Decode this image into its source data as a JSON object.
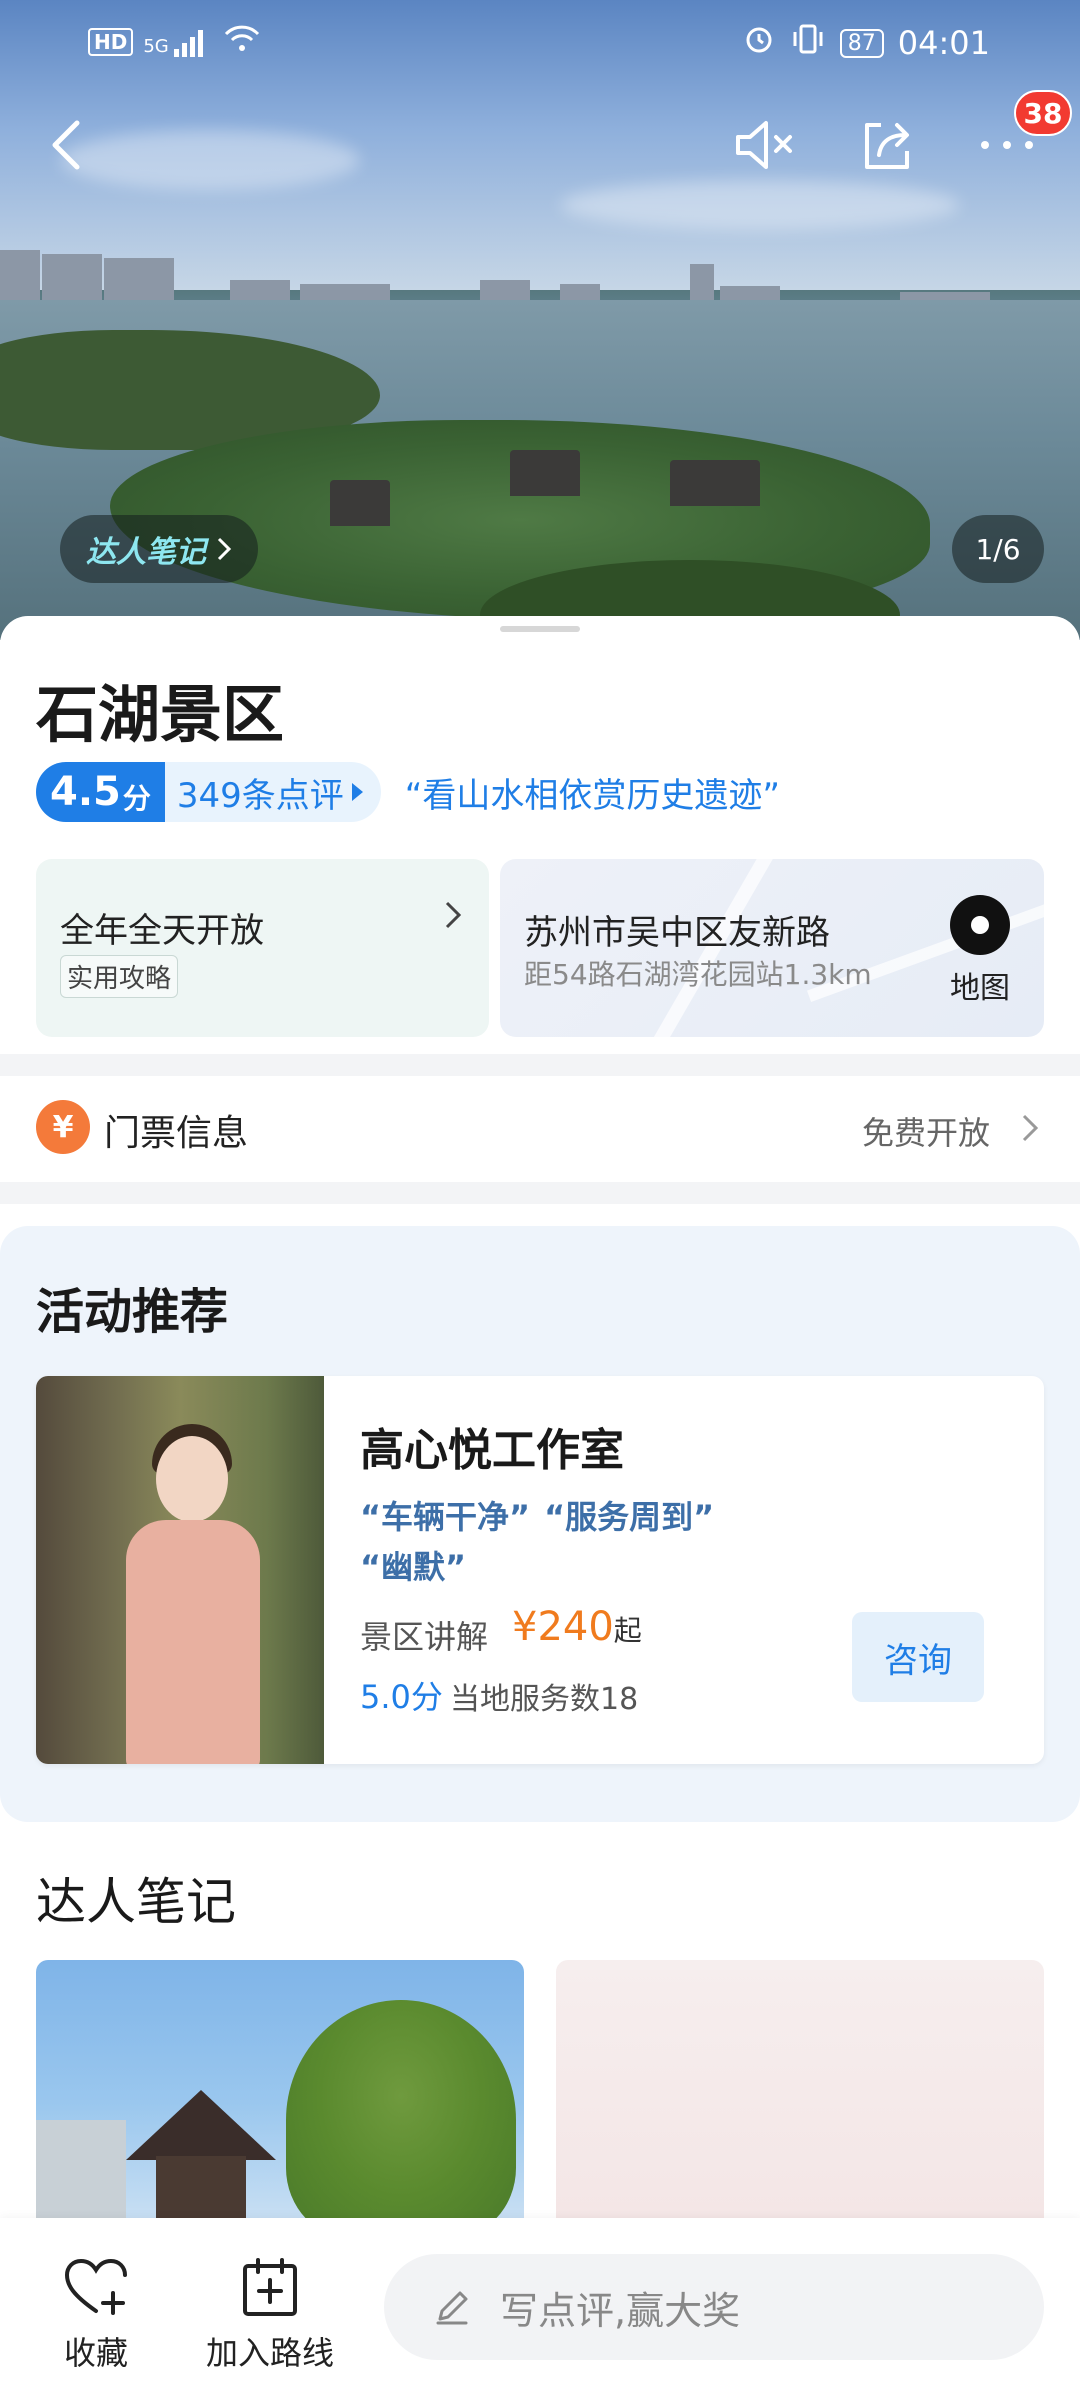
{
  "status_bar": {
    "network": "HD",
    "signal": "5G",
    "battery": "87",
    "time": "04:01"
  },
  "header": {
    "notification_count": "38"
  },
  "hero": {
    "expert_chip": "达人笔记",
    "page_indicator": "1/6"
  },
  "attraction": {
    "name": "石湖景区",
    "rating": "4.5",
    "rating_unit": "分",
    "review_count": "349条点评",
    "quote": "“看山水相依赏历史遗迹”"
  },
  "hours": {
    "main": "全年全天开放",
    "tag": "实用攻略"
  },
  "address": {
    "main": "苏州市吴中区友新路",
    "sub": "距54路石湖湾花园站1.3km",
    "map_label": "地图"
  },
  "ticket": {
    "icon": "¥",
    "label": "门票信息",
    "value": "免费开放"
  },
  "activity": {
    "title": "活动推荐",
    "card": {
      "name": "高心悦工作室",
      "tags": [
        "“车辆干净”",
        "“服务周到”",
        "“幽默”"
      ],
      "type": "景区讲解",
      "price": "¥240",
      "price_suffix": "起",
      "score": "5.0分",
      "served": "当地服务数18",
      "consult": "咨询"
    }
  },
  "notes": {
    "title": "达人笔记"
  },
  "bottom_bar": {
    "favorite": "收藏",
    "add_route": "加入路线",
    "review_placeholder": "写点评,赢大奖"
  },
  "colors": {
    "accent_blue": "#1f7ee6",
    "price_orange": "#f07b1e",
    "badge_red": "#f23a31",
    "ticket_orange": "#f47a3a"
  },
  "icons": [
    "back-arrow-icon",
    "mute-icon",
    "share-icon",
    "more-icon",
    "map-pin-icon",
    "ticket-icon",
    "heart-plus-icon",
    "calendar-plus-icon",
    "pencil-icon",
    "chevron-right-icon"
  ]
}
